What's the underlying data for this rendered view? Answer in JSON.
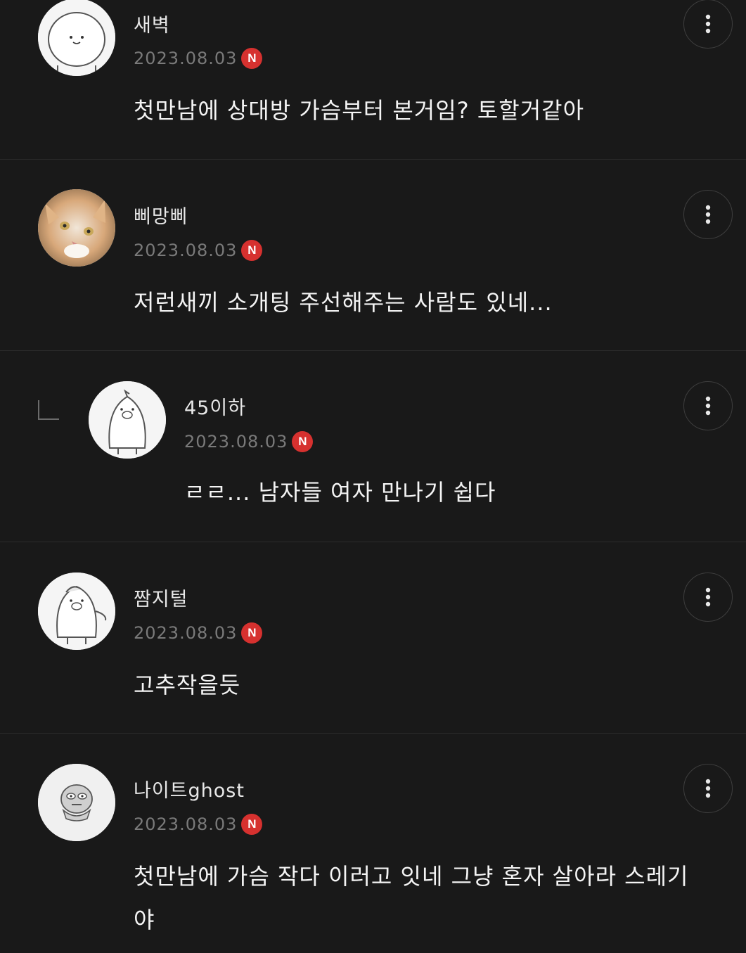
{
  "comments": [
    {
      "author": "새벽",
      "date": "2023.08.03",
      "badge": "N",
      "text": "첫만남에 상대방 가슴부터 본거임? 토할거같아",
      "avatar_icon": "smiling-face-avatar-icon",
      "is_reply": false
    },
    {
      "author": "삐망삐",
      "date": "2023.08.03",
      "badge": "N",
      "text": "저런새끼 소개팅 주선해주는 사람도 있네...",
      "avatar_icon": "cat-photo-avatar-icon",
      "is_reply": false
    },
    {
      "author": "45이하",
      "date": "2023.08.03",
      "badge": "N",
      "text": "ㄹㄹ... 남자들 여자 만나기 쉽다",
      "avatar_icon": "penguin-avatar-icon",
      "is_reply": true
    },
    {
      "author": "짬지털",
      "date": "2023.08.03",
      "badge": "N",
      "text": "고추작을듯",
      "avatar_icon": "penguin-waving-avatar-icon",
      "is_reply": false
    },
    {
      "author": "나이트ghost",
      "date": "2023.08.03",
      "badge": "N",
      "text": "첫만남에 가슴 작다 이러고 잇네 그냥 혼자 살아라 스레기야",
      "avatar_icon": "crying-character-avatar-icon",
      "is_reply": false
    }
  ],
  "icons": {
    "more_options": "vertical-dots-icon",
    "reply_indicator": "reply-corner-icon"
  },
  "colors": {
    "background": "#191919",
    "new_badge": "#d6312f",
    "date_text": "#7a7a7a"
  }
}
